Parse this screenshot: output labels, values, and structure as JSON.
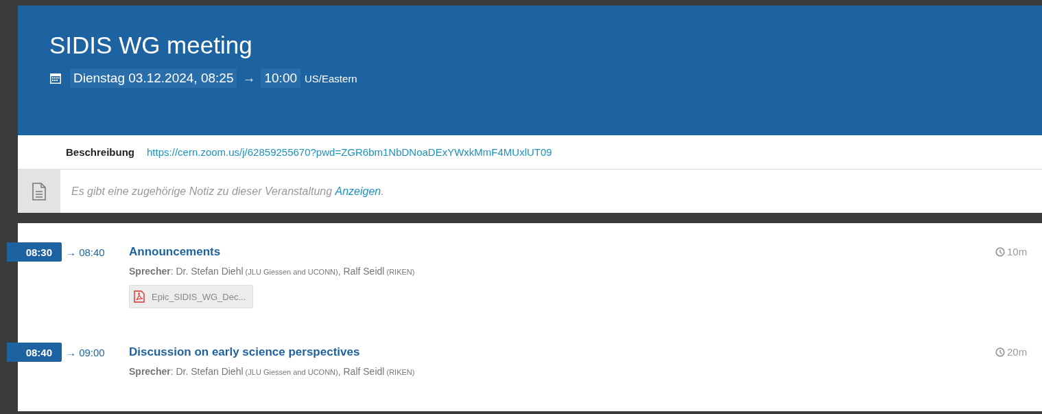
{
  "event": {
    "title": "SIDIS WG meeting",
    "start": "Dienstag 03.12.2024, 08:25",
    "arrow": "→",
    "end": "10:00",
    "timezone": "US/Eastern"
  },
  "description": {
    "label": "Beschreibung",
    "link": "https://cern.zoom.us/j/62859255670?pwd=ZGR6bm1NbDNoaDExYWxkMmF4MUxlUT09"
  },
  "note": {
    "text": "Es gibt eine zugehörige Notiz zu dieser Veranstaltung",
    "link": "Anzeigen",
    "end": "."
  },
  "contributions": [
    {
      "start": "08:30",
      "end": "→ 08:40",
      "title": "Announcements",
      "duration": "10m",
      "speakers": [
        {
          "kind": "label",
          "text": "Sprecher"
        },
        {
          "kind": "plain",
          "text": ": "
        },
        {
          "kind": "name",
          "text": "Dr. Stefan Diehl"
        },
        {
          "kind": "affil",
          "text": " (JLU Giessen and UCONN)"
        },
        {
          "kind": "plain",
          "text": ", "
        },
        {
          "kind": "name",
          "text": "Ralf Seidl"
        },
        {
          "kind": "affil",
          "text": " (RIKEN)"
        }
      ],
      "attachments": [
        "Epic_SIDIS_WG_Dec..."
      ]
    },
    {
      "start": "08:40",
      "end": "→ 09:00",
      "title": "Discussion on early science perspectives",
      "duration": "20m",
      "speakers": [
        {
          "kind": "label",
          "text": "Sprecher"
        },
        {
          "kind": "plain",
          "text": ": "
        },
        {
          "kind": "name",
          "text": "Dr. Stefan Diehl"
        },
        {
          "kind": "affil",
          "text": " (JLU Giessen and UCONN)"
        },
        {
          "kind": "plain",
          "text": ", "
        },
        {
          "kind": "name",
          "text": "Ralf Seidl"
        },
        {
          "kind": "affil",
          "text": " (RIKEN)"
        }
      ]
    }
  ]
}
